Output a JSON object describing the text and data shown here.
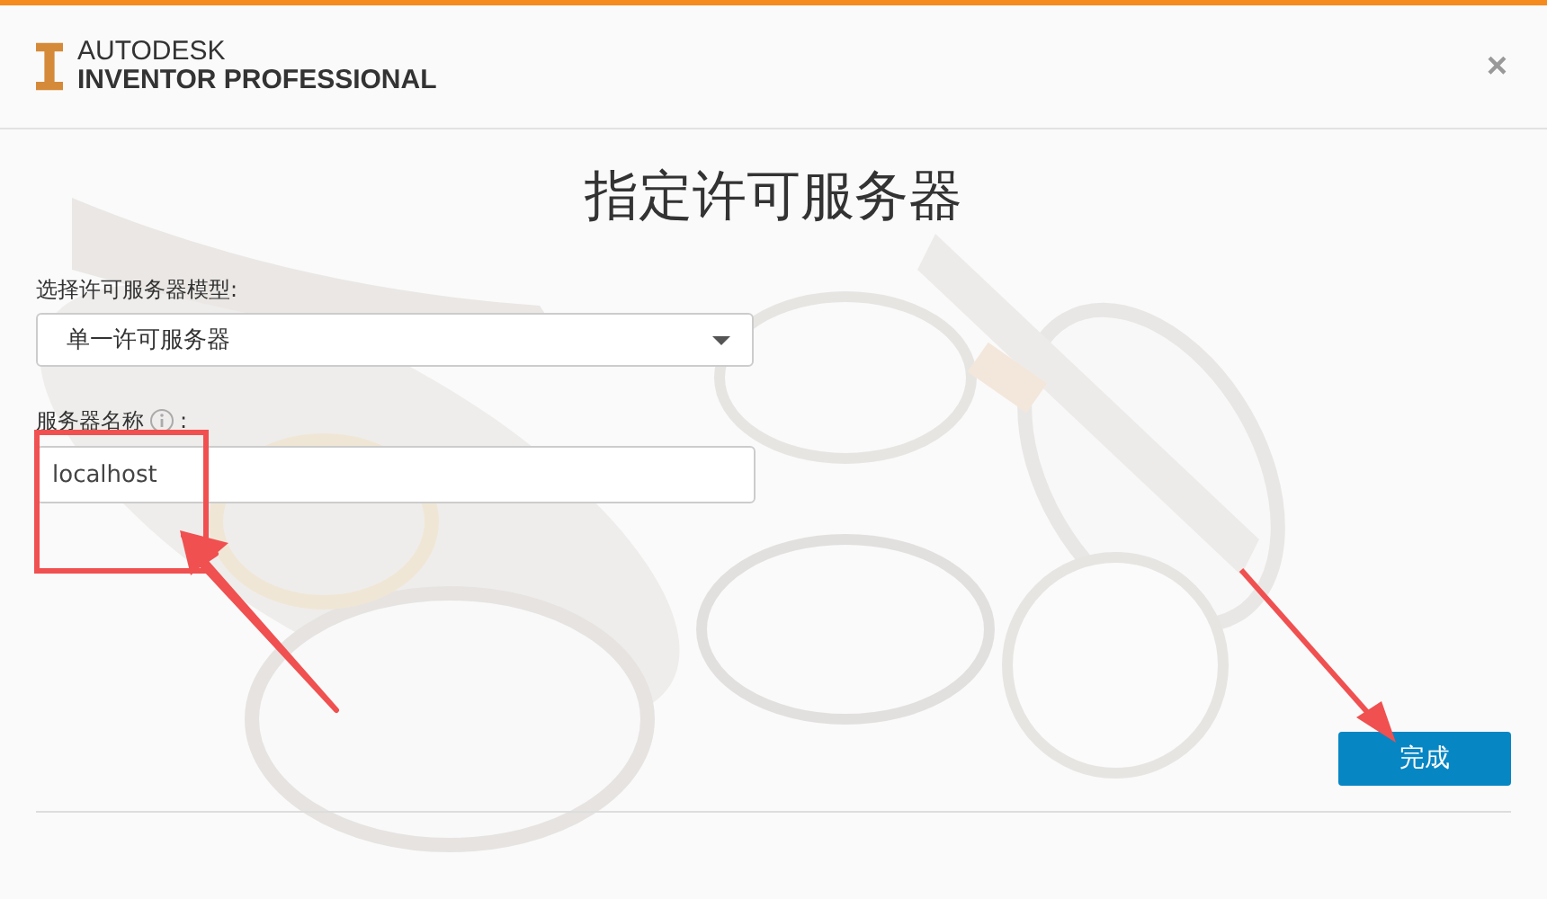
{
  "header": {
    "brand": "AUTODESK",
    "product": "INVENTOR",
    "edition": "PROFESSIONAL",
    "close": "×"
  },
  "title": "指定许可服务器",
  "model_field": {
    "label": "选择许可服务器模型:",
    "value": "单一许可服务器"
  },
  "server_field": {
    "label": "服务器名称",
    "suffix": ":",
    "value": "localhost"
  },
  "buttons": [
    "完成"
  ]
}
